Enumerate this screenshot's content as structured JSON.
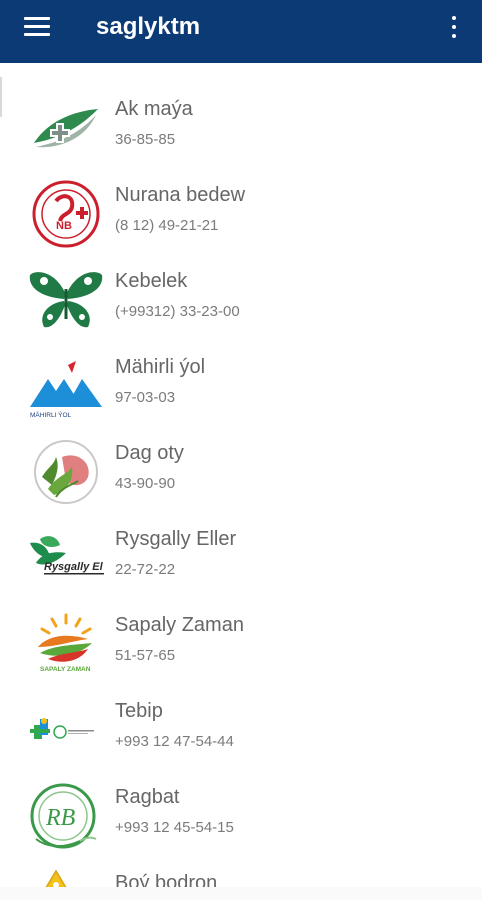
{
  "app": {
    "title": "saglyktm"
  },
  "colors": {
    "appbar": "#0b3a75",
    "name_text": "#666666",
    "phone_text": "#7b7b7b"
  },
  "toolbar": {
    "menu_icon": "hamburger-menu-icon",
    "more_icon": "more-vert-icon"
  },
  "items": [
    {
      "name": "Ak maýa",
      "phone": "36-85-85",
      "logo": "ak-maya-logo"
    },
    {
      "name": "Nurana bedew",
      "phone": "(8 12) 49-21-21",
      "logo": "nurana-bedew-logo"
    },
    {
      "name": "Kebelek",
      "phone": "(+99312) 33-23-00",
      "logo": "kebelek-butterfly-logo"
    },
    {
      "name": "Mähirli ýol",
      "phone": "97-03-03",
      "logo": "mahirli-yol-logo"
    },
    {
      "name": "Dag oty",
      "phone": "43-90-90",
      "logo": "dag-oty-logo"
    },
    {
      "name": "Rysgally Eller",
      "phone": "22-72-22",
      "logo": "rysgally-eller-logo"
    },
    {
      "name": "Sapaly Zaman",
      "phone": "51-57-65",
      "logo": "sapaly-zaman-logo"
    },
    {
      "name": "Tebip",
      "phone": "+993 12 47-54-44",
      "logo": "tebip-logo"
    },
    {
      "name": "Ragbat",
      "phone": "+993 12 45-54-15",
      "logo": "ragbat-logo"
    },
    {
      "name": "Boý bodron",
      "phone": "",
      "logo": "boy-bodron-logo"
    }
  ],
  "logo_text": {
    "nurana": "NB",
    "mahirli": "MÄHIRLI ÝOL",
    "rysgally": "Rysgally El",
    "sapaly": "SAPALY ZAMAN",
    "ragbat": "RB"
  }
}
